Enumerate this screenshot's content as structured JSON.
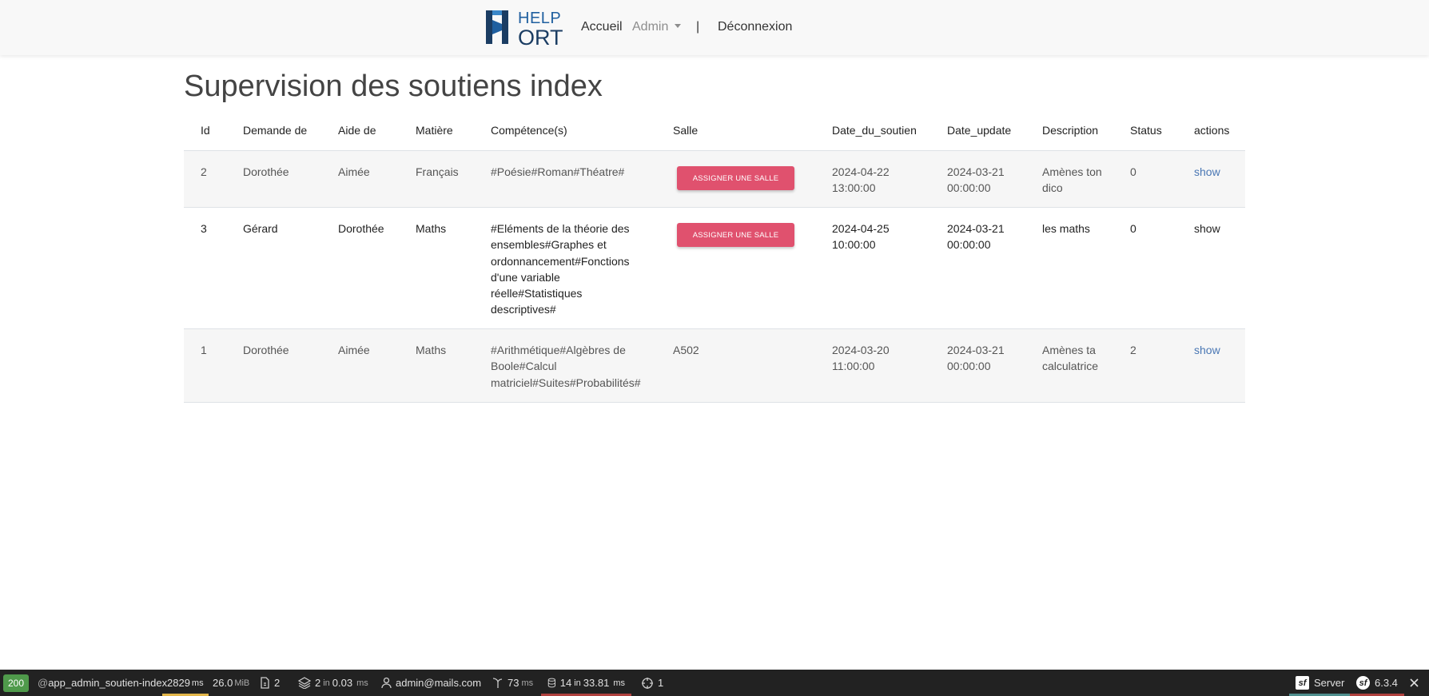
{
  "navbar": {
    "logo_help": "HELP",
    "logo_ort": "ORT",
    "accueil": "Accueil",
    "admin": "Admin",
    "separator": "|",
    "logout": "Déconnexion"
  },
  "page_title": "Supervision des soutiens index",
  "table": {
    "headers": {
      "id": "Id",
      "demande": "Demande de",
      "aide": "Aide de",
      "matiere": "Matière",
      "competences": "Compétence(s)",
      "salle": "Salle",
      "date_soutien": "Date_du_soutien",
      "date_update": "Date_update",
      "description": "Description",
      "status": "Status",
      "actions": "actions"
    },
    "assign_button_label": "Assigner une salle",
    "rows": [
      {
        "id": "2",
        "demande": "Dorothée",
        "aide": "Aimée",
        "matiere": "Français",
        "competences": "#Poésie#Roman#Théatre#",
        "salle": "",
        "date_soutien": "2024-04-22 13:00:00",
        "date_update": "2024-03-21 00:00:00",
        "description": "Amènes ton dico",
        "status": "0",
        "action": "show"
      },
      {
        "id": "3",
        "demande": "Gérard",
        "aide": "Dorothée",
        "matiere": "Maths",
        "competences": "#Eléments de la théorie des ensembles#Graphes et ordonnancement#Fonctions d'une variable réelle#Statistiques descriptives#",
        "salle": "",
        "date_soutien": "2024-04-25 10:00:00",
        "date_update": "2024-03-21 00:00:00",
        "description": "les maths",
        "status": "0",
        "action": "show"
      },
      {
        "id": "1",
        "demande": "Dorothée",
        "aide": "Aimée",
        "matiere": "Maths",
        "competences": "#Arithmétique#Algèbres de Boole#Calcul matriciel#Suites#Probabilités#",
        "salle": "A502",
        "date_soutien": "2024-03-20 11:00:00",
        "date_update": "2024-03-21 00:00:00",
        "description": "Amènes ta calculatrice",
        "status": "2",
        "action": "show"
      }
    ]
  },
  "debug_toolbar": {
    "status_code": "200",
    "route_prefix": "@",
    "route": "app_admin_soutien-index",
    "time_value": "2829",
    "time_unit": "ms",
    "memory_value": "26.0",
    "memory_unit": "MiB",
    "forms": "2",
    "cache_calls": "2",
    "cache_in": "in",
    "cache_time": "0.03",
    "cache_unit": "ms",
    "user": "admin@mails.com",
    "twig_time": "73",
    "twig_unit": "ms",
    "db_queries": "14",
    "db_in": "in",
    "db_time": "33.81",
    "db_unit": "ms",
    "translation": "1",
    "server_label": "Server",
    "symfony_version": "6.3.4",
    "colors": {
      "status_ok": "#4f9a4b",
      "time_warning": "#e3b64a",
      "db_error": "#b0413e",
      "server_accent": "#4f8f8e"
    }
  }
}
